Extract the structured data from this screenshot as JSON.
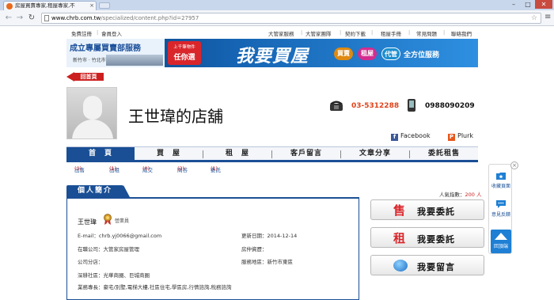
{
  "browser": {
    "tab_title": "房屋買賣專家,租屋專家,不",
    "url_host": "www.chrb.com.tw",
    "url_path": "/specialized/content.php?id=27957",
    "window_controls": [
      "–",
      "□",
      "✕"
    ]
  },
  "top_links": [
    "免費註冊",
    "會員登入",
    "大管家服務",
    "大管家團隊",
    "契約下載",
    "租屋手冊",
    "常見問題",
    "聯絡我們"
  ],
  "banner": {
    "title": "成立專屬買賣部服務",
    "sub": "新竹市 · 竹北市",
    "badge_top": "上千筆物件",
    "badge_bottom": "任你選",
    "main": "我要買屋",
    "pills": [
      "買賣",
      "租屋",
      "代管"
    ],
    "tail": "全方位服務"
  },
  "back_home": "回首頁",
  "store": {
    "name": "王世瑋的店舖",
    "phone": "03-5312288",
    "mobile": "0988090209",
    "facebook": "Facebook",
    "plurk": "Plurk"
  },
  "main_nav": [
    "首　頁",
    "買　屋",
    "租　屋",
    "客戶留言",
    "文章分享",
    "委託租售"
  ],
  "sub_nav": [
    {
      "label": "出售",
      "count": "(0)"
    },
    {
      "label": "出租",
      "count": "(1)"
    },
    {
      "label": "成交",
      "count": "(0)"
    },
    {
      "label": "問答",
      "count": "(3)"
    },
    {
      "label": "委託",
      "count": "(1)"
    }
  ],
  "intro": {
    "tab": "個人簡介",
    "agent_name": "王世瑋",
    "agent_title": "營業員",
    "email_label": "E-mail：",
    "email": "chrb.yj0066@gmail.com",
    "updated_label": "更新日期：",
    "updated": "2014-12-14",
    "company_label": "在職公司：",
    "company": "大管家房屋管理",
    "license_label": "房仲資歷：",
    "license": "",
    "branch_label": "公司分店：",
    "branch": "",
    "area_label": "服務地區：",
    "area": "新竹市東區",
    "community_label": "深耕社區：",
    "community": "光華商圈、巨城商圈",
    "specialty_label": "業務專長：",
    "specialty": "豪宅/別墅,電梯大樓,社區住宅,學區房,行情諮詢,稅務諮詢"
  },
  "popularity": {
    "label": "人氣指數：",
    "value": "200",
    "unit": "人"
  },
  "action_buttons": [
    {
      "glyph": "售",
      "label": "我要委託"
    },
    {
      "glyph": "租",
      "label": "我要委託"
    },
    {
      "glyph": "",
      "label": "我要留言"
    }
  ],
  "float_tools": {
    "close": "×",
    "favorite": "收藏頁面",
    "feedback": "意見反饋",
    "top": "回頂端"
  }
}
